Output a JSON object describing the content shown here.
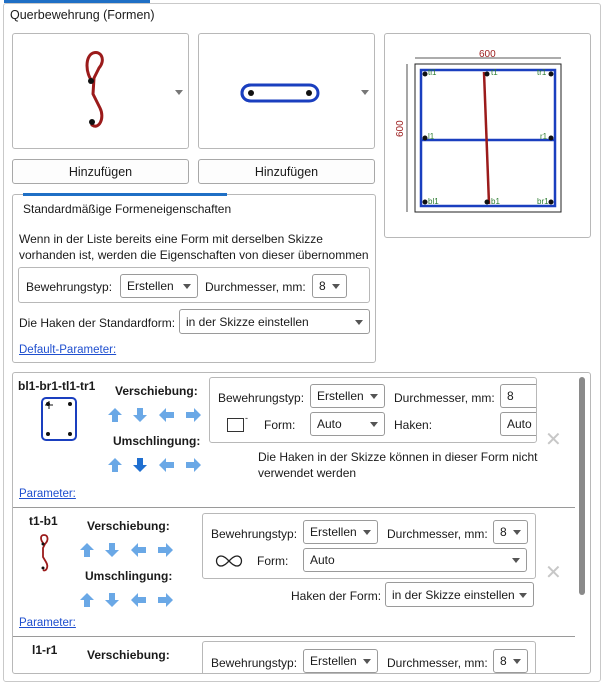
{
  "panel": {
    "title": "Querbewehrung (Formen)",
    "add_button_1": "Hinzufügen",
    "add_button_2": "Hinzufügen"
  },
  "preview": {
    "dim_top": "600",
    "dim_left": "600",
    "labels": {
      "tl1": "tl1",
      "t1": "t1",
      "tr1": "tr1",
      "l1": "l1",
      "r1": "r1",
      "bl1": "bl1",
      "b1": "b1",
      "br1": "br1"
    }
  },
  "standard": {
    "tab_label": "Standardmäßige Formeneigenschaften",
    "info_line1": "Wenn in der Liste bereits eine Form mit derselben Skizze",
    "info_line2": "vorhanden ist, werden die Eigenschaften von dieser übernommen",
    "type_label": "Bewehrungstyp:",
    "type_value": "Erstellen",
    "diameter_label": "Durchmesser, mm:",
    "diameter_value": "8",
    "hook_label": "Die Haken der Standardform:",
    "hook_value": "in der Skizze einstellen",
    "default_link": "Default-Parameter:"
  },
  "items": [
    {
      "title": "bl1-br1-tl1-tr1",
      "shift_label": "Verschiebung:",
      "wrap_label": "Umschlingung:",
      "type_label": "Bewehrungstyp:",
      "type_value": "Erstellen",
      "diameter_label": "Durchmesser, mm:",
      "diameter_value": "8",
      "form_label": "Form:",
      "form_value": "Auto",
      "hooks_label": "Haken:",
      "hooks_value": "Auto",
      "note_line1": "Die Haken in der Skizze können in dieser Form nicht",
      "note_line2": "verwendet werden",
      "params_link": "Parameter:"
    },
    {
      "title": "t1-b1",
      "shift_label": "Verschiebung:",
      "wrap_label": "Umschlingung:",
      "type_label": "Bewehrungstyp:",
      "type_value": "Erstellen",
      "diameter_label": "Durchmesser, mm:",
      "diameter_value": "8",
      "form_label": "Form:",
      "form_value": "Auto",
      "hook_form_label": "Haken der Form:",
      "hook_form_value": "in der Skizze einstellen",
      "params_link": "Parameter:"
    },
    {
      "title": "l1-r1",
      "shift_label": "Verschiebung:",
      "type_label": "Bewehrungstyp:",
      "type_value": "Erstellen",
      "diameter_label": "Durchmesser, mm:",
      "diameter_value": "8"
    }
  ],
  "colors": {
    "accent": "#1f6fc5",
    "rebar_red": "#9b1b1b",
    "rebar_blue": "#1a3fbf",
    "arrow_light": "#6aa8e6",
    "arrow_dark": "#1f6fd0",
    "label_green": "#2e7d32"
  }
}
